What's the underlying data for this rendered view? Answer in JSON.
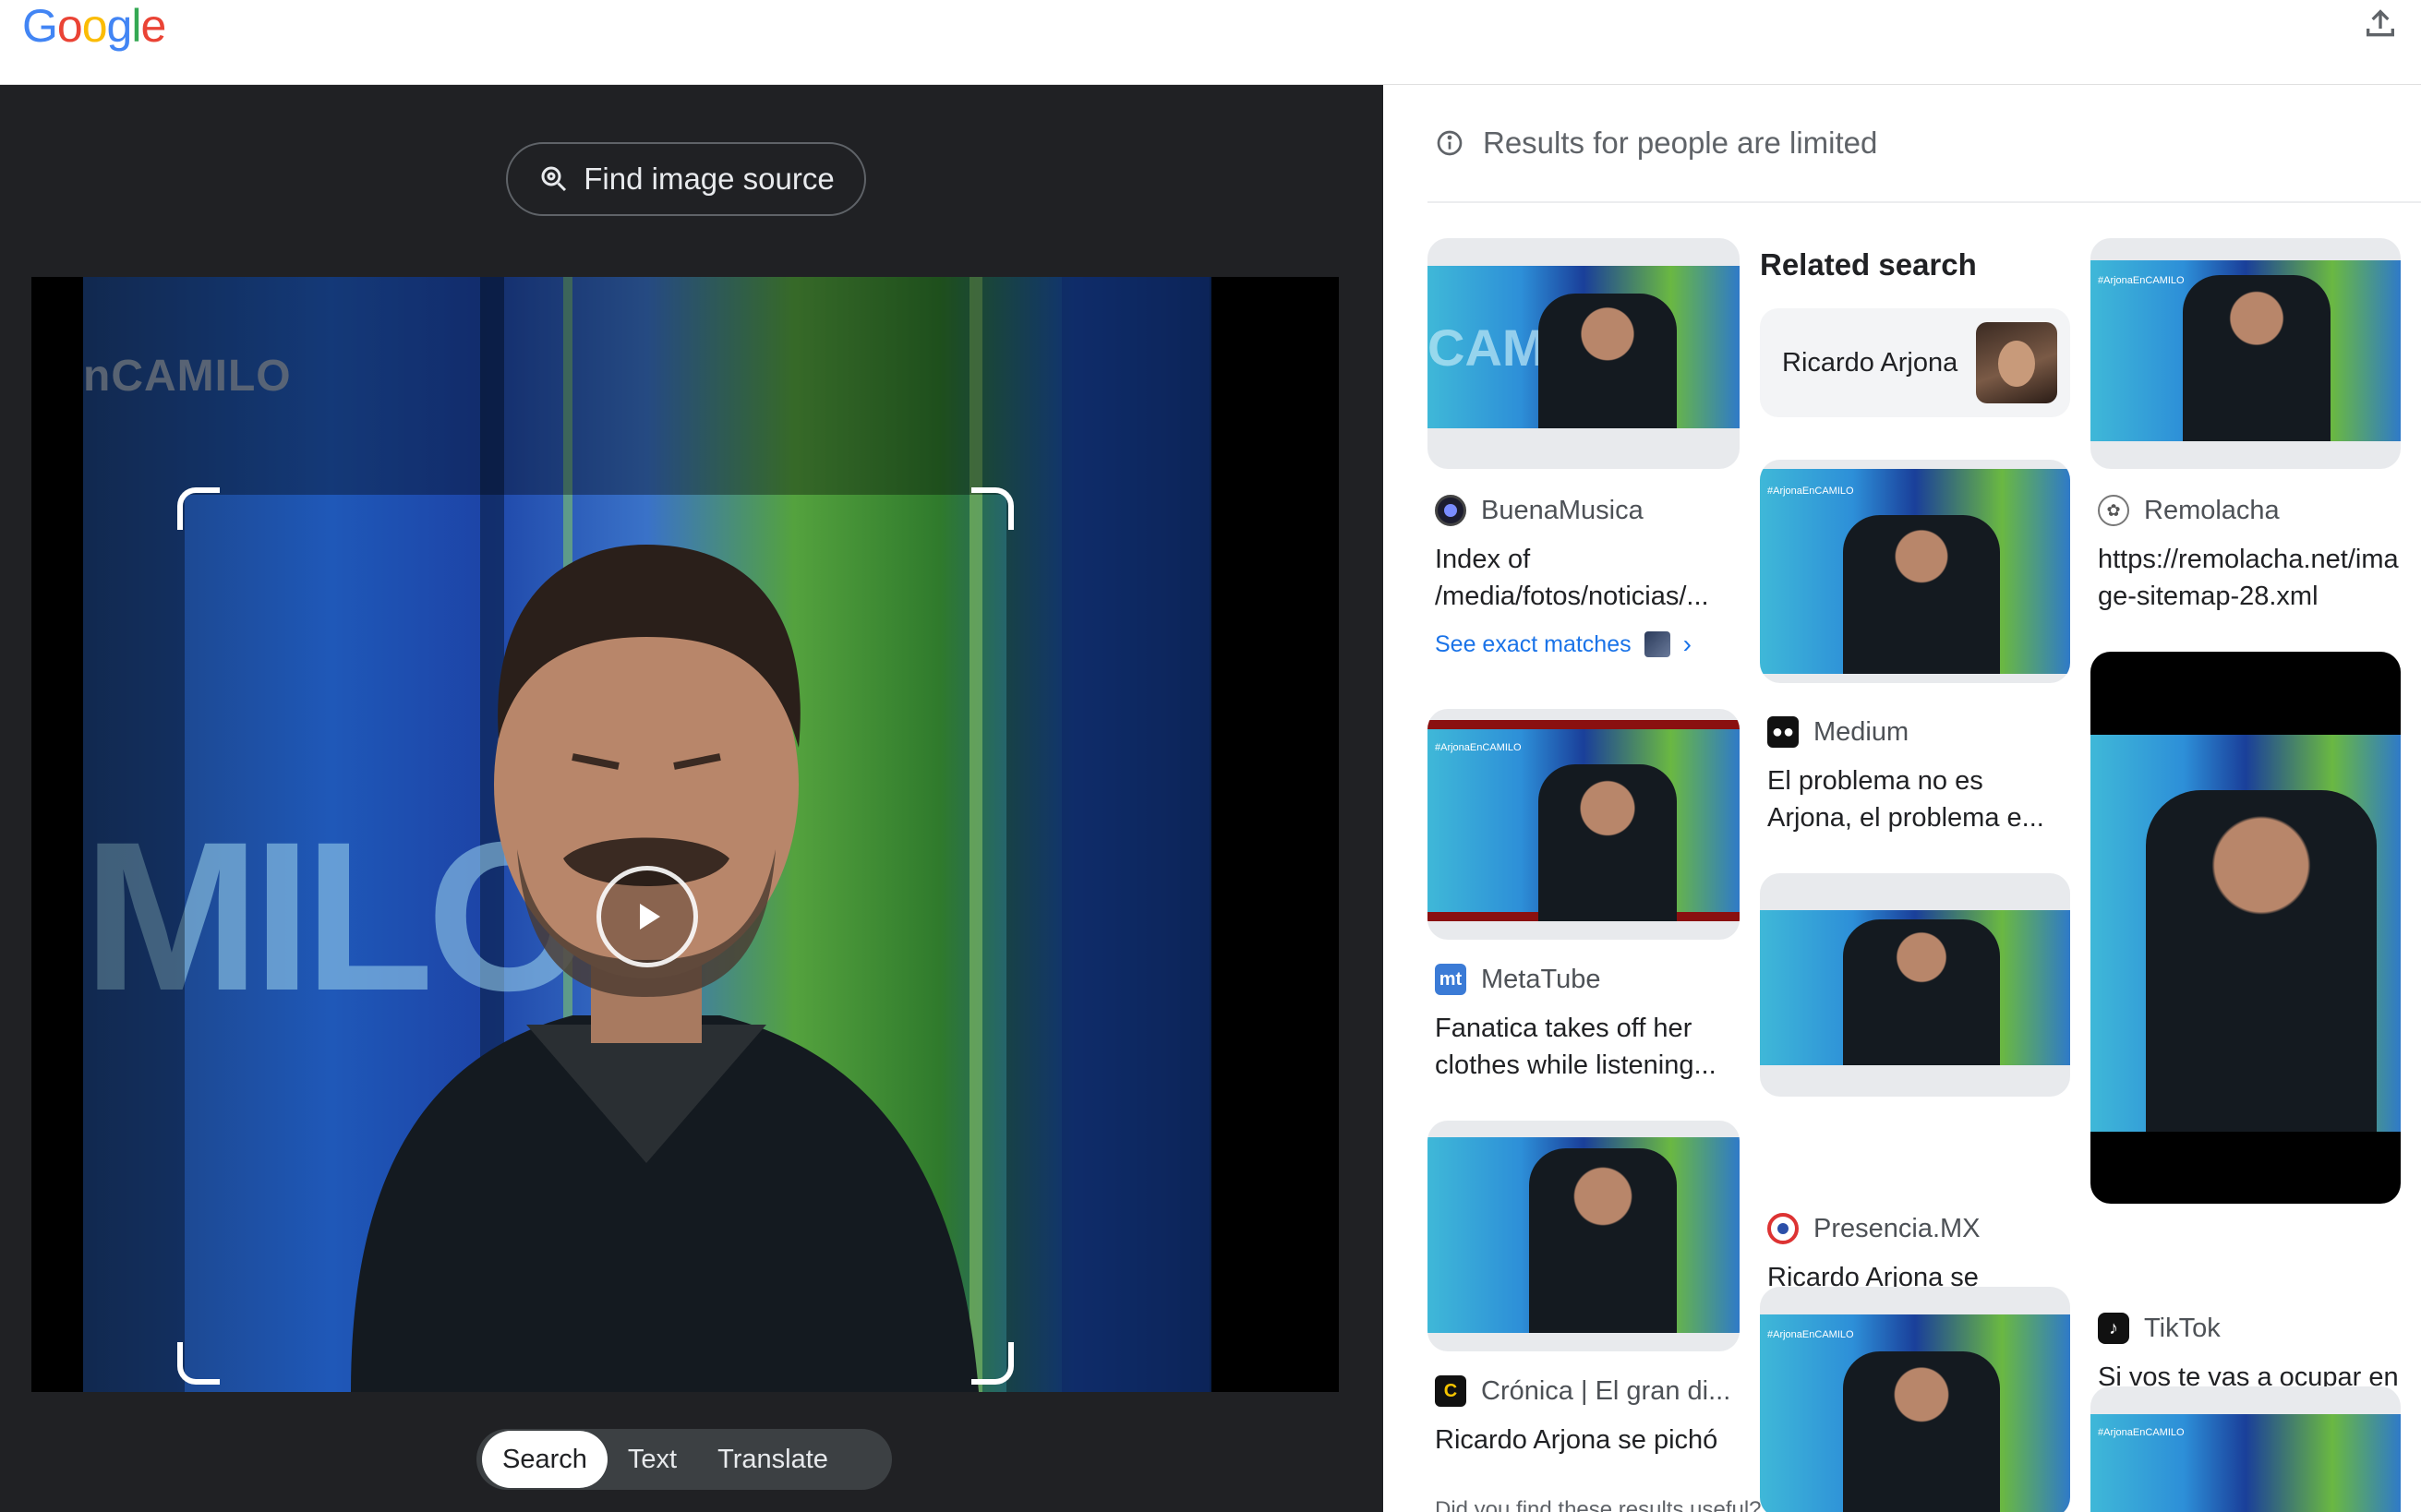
{
  "header": {
    "logo": [
      "G",
      "o",
      "o",
      "g",
      "l",
      "e"
    ],
    "logo_colors": [
      "#4285F4",
      "#EA4335",
      "#FBBC05",
      "#4285F4",
      "#34A853",
      "#EA4335"
    ],
    "upload_icon": "upload-icon"
  },
  "left_pane": {
    "find_source_label": "Find image source",
    "frame_logo_tag": "nCAMILO",
    "frame_big_text": "MILO",
    "modes": [
      {
        "label": "Search",
        "active": true
      },
      {
        "label": "Text",
        "active": false
      },
      {
        "label": "Translate",
        "active": false
      }
    ]
  },
  "right_pane": {
    "limited_notice": "Results for people are limited",
    "related_search": {
      "heading": "Related search",
      "chip_label": "Ricardo Arjona"
    },
    "col1": [
      {
        "source": "BuenaMusica",
        "title": "Index of /media/fotos/noticias/...",
        "exact": "See exact matches"
      },
      {
        "source": "MetaTube",
        "title": "Fanatica takes off her clothes while listening..."
      },
      {
        "source": "Crónica | El gran di...",
        "title": "Ricardo Arjona se pichó"
      }
    ],
    "col2": [
      {
        "source": "Medium",
        "title": "El problema no es Arjona, el problema e..."
      },
      {
        "source": "Presencia.MX",
        "title": "Ricardo Arjona se enfrascó en una..."
      }
    ],
    "col3": [
      {
        "source": "Remolacha",
        "title": "https://remolacha.net/image-sitemap-28.xml"
      },
      {
        "source": "TikTok",
        "title": "Si vos te vas a ocupar en odiar a alguien ere..."
      }
    ],
    "thumb_tags": [
      "#ArjonaEnCAMILO",
      "CAMILO"
    ],
    "bottom_cut": "Did you find these results useful?"
  },
  "colors": {
    "accent_blue": "#1a73e8",
    "dark_bg": "#202124"
  }
}
